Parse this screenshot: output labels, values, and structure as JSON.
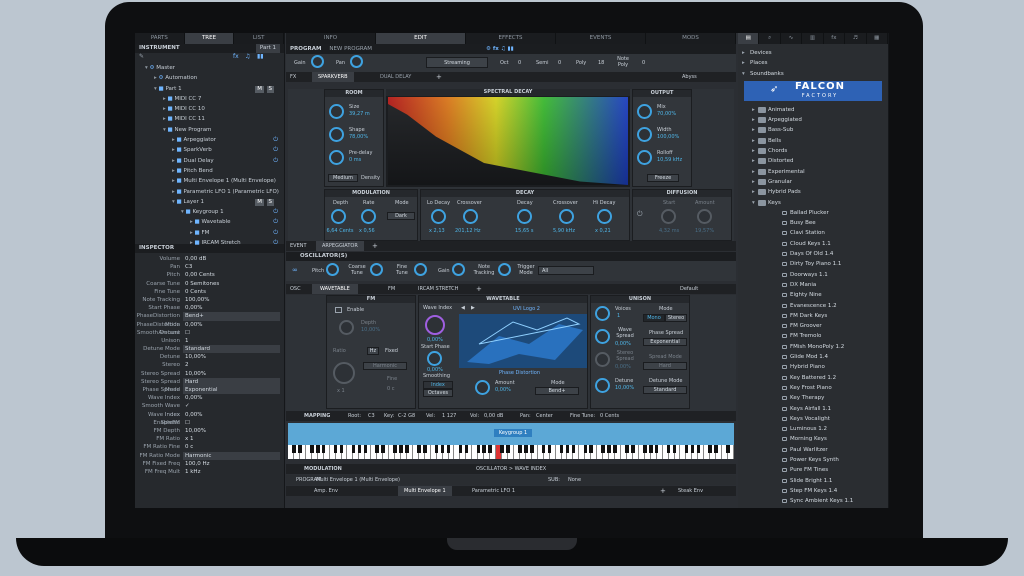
{
  "top_tabs": [
    "PARTS",
    "TREE",
    "LIST"
  ],
  "center_tabs": [
    "INFO",
    "EDIT",
    "EFFECTS",
    "EVENTS",
    "MODS"
  ],
  "instrument": {
    "header": "INSTRUMENT",
    "part": "Part 1",
    "tree": [
      {
        "label": "Master",
        "d": 0,
        "icon": "gear"
      },
      {
        "label": "Automation",
        "d": 1,
        "icon": "gear"
      },
      {
        "label": "Part 1",
        "d": 1,
        "icon": "part",
        "m": "M",
        "s": "S"
      },
      {
        "label": "MIDI CC 7",
        "d": 2
      },
      {
        "label": "MIDI CC 10",
        "d": 2
      },
      {
        "label": "MIDI CC 11",
        "d": 2
      },
      {
        "label": "New Program",
        "d": 2,
        "icon": "prog"
      },
      {
        "label": "Arpeggiator",
        "d": 3,
        "pw": true
      },
      {
        "label": "SparkVerb",
        "d": 3,
        "pw": true
      },
      {
        "label": "Dual Delay",
        "d": 3,
        "pw": true
      },
      {
        "label": "Pitch Bend",
        "d": 3
      },
      {
        "label": "Multi Envelope 1 (Multi Envelope)",
        "d": 3
      },
      {
        "label": "Parametric LFO 1 (Parametric LFO)",
        "d": 3
      },
      {
        "label": "Layer 1",
        "d": 3,
        "m": "M",
        "s": "S"
      },
      {
        "label": "Keygroup 1",
        "d": 4,
        "pw": true
      },
      {
        "label": "Wavetable",
        "d": 5,
        "pw": true
      },
      {
        "label": "FM",
        "d": 5,
        "pw": true
      },
      {
        "label": "IRCAM Stretch",
        "d": 5,
        "pw": true
      }
    ]
  },
  "inspector": {
    "header": "INSPECTOR",
    "rows": [
      [
        "Volume",
        "0,00 dB",
        false
      ],
      [
        "Pan",
        "C3",
        false
      ],
      [
        "Pitch",
        "0,00 Cents",
        false
      ],
      [
        "Coarse Tune",
        "0 Semitones",
        false
      ],
      [
        "Fine Tune",
        "0 Cents",
        false
      ],
      [
        "Note Tracking",
        "100,00%",
        false
      ],
      [
        "Start Phase",
        "0,00%",
        false
      ],
      [
        "PhaseDistortion Mode",
        "Bend+",
        true
      ],
      [
        "PhaseDistortion Amount",
        "0,00%",
        false
      ],
      [
        "Smooth Detune",
        "☐",
        false
      ],
      [
        "Unison",
        "1",
        false
      ],
      [
        "Detune Mode",
        "Standard",
        true
      ],
      [
        "Detune",
        "10,00%",
        false
      ],
      [
        "Stereo",
        "2",
        false
      ],
      [
        "Stereo Spread",
        "10,00%",
        false
      ],
      [
        "Stereo Spread Mode",
        "Hard",
        true
      ],
      [
        "Phase Spread",
        "Exponential",
        true
      ],
      [
        "Wave Index",
        "0,00%",
        false
      ],
      [
        "Smooth Wave Index",
        "✓",
        false
      ],
      [
        "Wave Index Spread",
        "0,00%",
        false
      ],
      [
        "EnableFM",
        "☐",
        false
      ],
      [
        "FM Depth",
        "10,00%",
        false
      ],
      [
        "FM Ratio",
        "x 1",
        false
      ],
      [
        "FM Ratio Fine",
        "0 c",
        false
      ],
      [
        "FM Ratio Mode",
        "Harmonic",
        true
      ],
      [
        "FM Fixed Freq",
        "100,0 Hz",
        false
      ],
      [
        "FM Freq Mult",
        "1 kHz",
        false
      ]
    ]
  },
  "program": {
    "title": "PROGRAM",
    "name": "NEW PROGRAM",
    "gain_label": "Gain",
    "pan_label": "Pan",
    "streaming": "Streaming",
    "oct_label": "Oct",
    "oct": "0",
    "semi_label": "Semi",
    "semi": "0",
    "poly_label": "Poly",
    "poly": "18",
    "notepoly_label": "Note Poly",
    "notepoly": "0"
  },
  "fx": {
    "label": "FX",
    "tabs": [
      "SPARKVERB",
      "DUAL DELAY"
    ],
    "preset": "Abyss"
  },
  "sparkverb": {
    "room": {
      "title": "ROOM",
      "size_label": "Size",
      "size": "39,27 m",
      "shape_label": "Shape",
      "shape": "78,00%",
      "predelay_label": "Pre-delay",
      "predelay": "0 ms",
      "density_sel": "Medium",
      "density_label": "Density"
    },
    "spectral": {
      "title": "SPECTRAL DECAY"
    },
    "output": {
      "title": "OUTPUT",
      "mix_label": "Mix",
      "mix": "70,00%",
      "width_label": "Width",
      "width": "100,00%",
      "rolloff_label": "Rolloff",
      "rolloff": "10,59 kHz",
      "freeze": "Freeze"
    },
    "modulation": {
      "title": "MODULATION",
      "depth_label": "Depth",
      "depth": "6,64 Cents",
      "rate_label": "Rate",
      "rate": "x 0,56",
      "mode_label": "Mode",
      "mode": "Dark"
    },
    "decay": {
      "title": "DECAY",
      "lodecay_label": "Lo Decay",
      "lodecay": "x 2,13",
      "crossover1_label": "Crossover",
      "crossover1": "201,12 Hz",
      "decay_label": "Decay",
      "decay": "15,65 s",
      "crossover2_label": "Crossover",
      "crossover2": "5,90 kHz",
      "hidecay_label": "Hi Decay",
      "hidecay": "x 0,21"
    },
    "diffusion": {
      "title": "DIFFUSION",
      "start_label": "Start",
      "start": "4,32 ms",
      "amount_label": "Amount",
      "amount": "19,57%"
    }
  },
  "event": {
    "label": "EVENT",
    "arp": "ARPEGGIATOR"
  },
  "oscillators": {
    "title": "OSCILLATOR(S)",
    "pitch_label": "Pitch",
    "coarse_label": "Coarse Tune",
    "fine_label": "Fine Tune",
    "gain_label": "Gain",
    "notetrack_label": "Note Tracking",
    "trigger_label": "Trigger Mode",
    "trigger": "All"
  },
  "osc": {
    "label": "OSC",
    "tabs": [
      "WAVETABLE",
      "FM",
      "IRCAM STRETCH"
    ],
    "preset": "Default",
    "fm": {
      "title": "FM",
      "enable": "Enable",
      "depth_label": "Depth",
      "depth": "10,00%",
      "ratio_label": "Ratio",
      "ratio": "x 1",
      "fine_label": "Fine",
      "fine": "0 c",
      "mode": "Harmonic",
      "fixed": "Fixed",
      "hz": "Hz"
    },
    "wavetable": {
      "title": "WAVETABLE",
      "waveindex_label": "Wave Index",
      "waveindex": "0,00%",
      "startphase_label": "Start Phase",
      "startphase": "0,00%",
      "smoothing_label": "Smoothing",
      "index": "Index",
      "octaves": "Octaves",
      "wavename": "UVI Logo 2",
      "pd_title": "Phase Distortion",
      "amount_label": "Amount",
      "amount": "0,00%",
      "mode_label": "Mode",
      "mode": "Bend+"
    },
    "unison": {
      "title": "UNISON",
      "voices_label": "Voices",
      "voices": "1",
      "mode_label": "Mode",
      "mono": "Mono",
      "stereo": "Stereo",
      "wavespread_label": "Wave Spread",
      "wavespread": "0,00%",
      "phasespread_label": "Phase Spread",
      "phasespread": "Exponential",
      "stereospread_label": "Stereo Spread",
      "stereospread": "0,00%",
      "spreadmode_label": "Spread Mode",
      "spreadmode": "Hard",
      "detune_label": "Detune",
      "detune": "10,00%",
      "detunemode_label": "Detune Mode",
      "detunemode": "Standard"
    }
  },
  "mapping": {
    "title": "MAPPING",
    "root_label": "Root:",
    "root": "C3",
    "key_label": "Key:",
    "key": "C-2 G8",
    "vel_label": "Vel:",
    "vel": "1  127",
    "vol_label": "Vol:",
    "vol": "0,00 dB",
    "pan_label": "Pan:",
    "pan": "Center",
    "finetune_label": "Fine Tune:",
    "finetune": "0 Cents",
    "keygroup": "Keygroup 1"
  },
  "modulation": {
    "title": "MODULATION",
    "path": "OSCILLATOR > WAVE INDEX",
    "program_label": "PROGRAM",
    "program": "Multi Envelope 1 (Multi Envelope)",
    "sub_label": "SUB:",
    "sub": "None",
    "tabs": [
      "Amp. Env",
      "Multi Envelope 1",
      "Parametric LFO 1"
    ],
    "steak": "Steak Env"
  },
  "browser": {
    "items": [
      "Devices",
      "Places",
      "Soundbanks"
    ],
    "logo_main": "FALCON",
    "logo_sub": "FACTORY",
    "folders": [
      "Animated",
      "Arpeggiated",
      "Bass-Sub",
      "Bells",
      "Chords",
      "Distorted",
      "Experimental",
      "Granular",
      "Hybrid Pads",
      "Keys"
    ],
    "files": [
      "Ballad Plucker",
      "Busy Bee",
      "Clavi Station",
      "Cloud Keys 1.1",
      "Days Of Old 1.4",
      "Dirty Toy Piano 1.1",
      "Doorways 1.1",
      "DX Mania",
      "Eighty Nine",
      "Evanescence 1.2",
      "FM Dark Keys",
      "FM Groover",
      "FM Tremolo",
      "FMish MonoPoly 1.2",
      "Glide Mod 1.4",
      "Hybrid Piano",
      "Key Battered 1.2",
      "Key Frost Piano",
      "Key Therapy",
      "Keys Airfall 1.1",
      "Keys Vocalight",
      "Luminous 1.2",
      "Morning Keys",
      "Paul Warlitzer",
      "Power Keys Synth",
      "Pure FM Tines",
      "Slide Bright 1.1",
      "Step FM Keys 1.4",
      "Sync Ambient Keys 1.1"
    ]
  },
  "colors": {
    "accent": "#3ea2e0",
    "bg": "#2b2e33",
    "logo_bg": "#2e62b5"
  }
}
